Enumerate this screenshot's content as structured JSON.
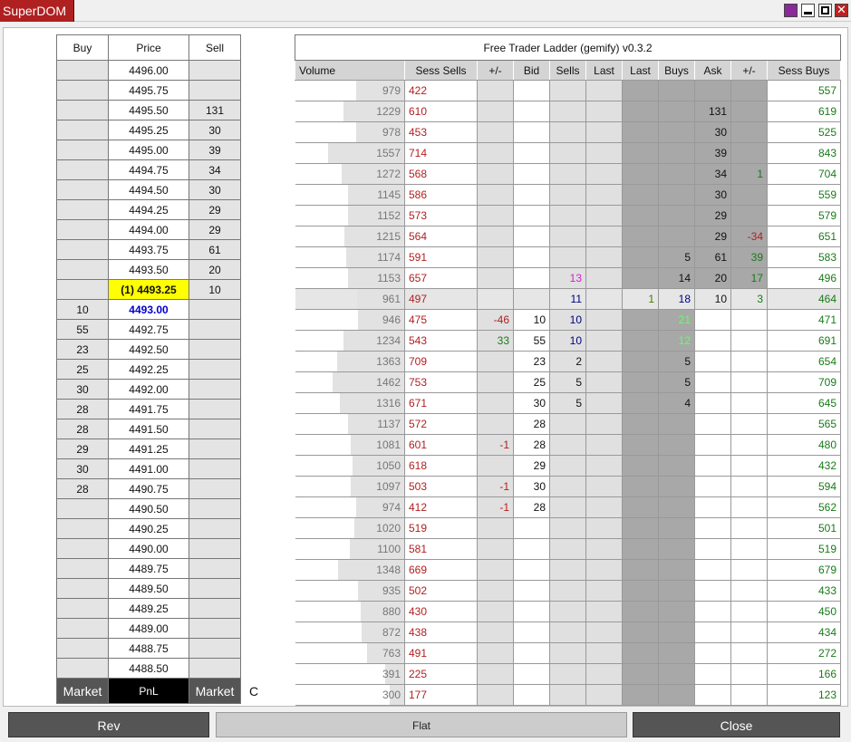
{
  "window": {
    "title": "SuperDOM"
  },
  "left": {
    "headers": [
      "Buy",
      "Price",
      "Sell"
    ],
    "rows": [
      {
        "buy": "",
        "price": "4496.00",
        "sell": ""
      },
      {
        "buy": "",
        "price": "4495.75",
        "sell": ""
      },
      {
        "buy": "",
        "price": "4495.50",
        "sell": "131"
      },
      {
        "buy": "",
        "price": "4495.25",
        "sell": "30"
      },
      {
        "buy": "",
        "price": "4495.00",
        "sell": "39"
      },
      {
        "buy": "",
        "price": "4494.75",
        "sell": "34"
      },
      {
        "buy": "",
        "price": "4494.50",
        "sell": "30"
      },
      {
        "buy": "",
        "price": "4494.25",
        "sell": "29"
      },
      {
        "buy": "",
        "price": "4494.00",
        "sell": "29"
      },
      {
        "buy": "",
        "price": "4493.75",
        "sell": "61"
      },
      {
        "buy": "",
        "price": "4493.50",
        "sell": "20"
      },
      {
        "buy": "",
        "price": "(1) 4493.25",
        "sell": "10",
        "highlight": "position"
      },
      {
        "buy": "10",
        "price": "4493.00",
        "sell": "",
        "highlight": "bid"
      },
      {
        "buy": "55",
        "price": "4492.75",
        "sell": ""
      },
      {
        "buy": "23",
        "price": "4492.50",
        "sell": ""
      },
      {
        "buy": "25",
        "price": "4492.25",
        "sell": ""
      },
      {
        "buy": "30",
        "price": "4492.00",
        "sell": ""
      },
      {
        "buy": "28",
        "price": "4491.75",
        "sell": ""
      },
      {
        "buy": "28",
        "price": "4491.50",
        "sell": ""
      },
      {
        "buy": "29",
        "price": "4491.25",
        "sell": ""
      },
      {
        "buy": "30",
        "price": "4491.00",
        "sell": ""
      },
      {
        "buy": "28",
        "price": "4490.75",
        "sell": ""
      },
      {
        "buy": "",
        "price": "4490.50",
        "sell": ""
      },
      {
        "buy": "",
        "price": "4490.25",
        "sell": ""
      },
      {
        "buy": "",
        "price": "4490.00",
        "sell": ""
      },
      {
        "buy": "",
        "price": "4489.75",
        "sell": ""
      },
      {
        "buy": "",
        "price": "4489.50",
        "sell": ""
      },
      {
        "buy": "",
        "price": "4489.25",
        "sell": ""
      },
      {
        "buy": "",
        "price": "4489.00",
        "sell": ""
      },
      {
        "buy": "",
        "price": "4488.75",
        "sell": ""
      },
      {
        "buy": "",
        "price": "4488.50",
        "sell": ""
      }
    ],
    "footer": [
      "Market",
      "PnL",
      "Market"
    ],
    "c_label": "C"
  },
  "right": {
    "title": "Free Trader Ladder (gemify) v0.3.2",
    "headers": [
      "Volume",
      "Sess Sells",
      "+/-",
      "Bid",
      "Sells",
      "Last",
      "Last",
      "Buys",
      "Ask",
      "+/-",
      "Sess Buys"
    ],
    "max_volume": 1557,
    "rows": [
      {
        "vol": "979",
        "ss": "422",
        "pmb": "",
        "bid": "",
        "sells": "",
        "lastL": "",
        "lastR": "",
        "buys": "",
        "ask": "",
        "pma": "",
        "sb": "557"
      },
      {
        "vol": "1229",
        "ss": "610",
        "pmb": "",
        "bid": "",
        "sells": "",
        "lastL": "",
        "lastR": "",
        "buys": "",
        "ask": "131",
        "pma": "",
        "sb": "619"
      },
      {
        "vol": "978",
        "ss": "453",
        "pmb": "",
        "bid": "",
        "sells": "",
        "lastL": "",
        "lastR": "",
        "buys": "",
        "ask": "30",
        "pma": "",
        "sb": "525"
      },
      {
        "vol": "1557",
        "ss": "714",
        "pmb": "",
        "bid": "",
        "sells": "",
        "lastL": "",
        "lastR": "",
        "buys": "",
        "ask": "39",
        "pma": "",
        "sb": "843"
      },
      {
        "vol": "1272",
        "ss": "568",
        "pmb": "",
        "bid": "",
        "sells": "",
        "lastL": "",
        "lastR": "",
        "buys": "",
        "ask": "34",
        "pma": "1",
        "sb": "704"
      },
      {
        "vol": "1145",
        "ss": "586",
        "pmb": "",
        "bid": "",
        "sells": "",
        "lastL": "",
        "lastR": "",
        "buys": "",
        "ask": "30",
        "pma": "",
        "sb": "559"
      },
      {
        "vol": "1152",
        "ss": "573",
        "pmb": "",
        "bid": "",
        "sells": "",
        "lastL": "",
        "lastR": "",
        "buys": "",
        "ask": "29",
        "pma": "",
        "sb": "579"
      },
      {
        "vol": "1215",
        "ss": "564",
        "pmb": "",
        "bid": "",
        "sells": "",
        "lastL": "",
        "lastR": "",
        "buys": "",
        "ask": "29",
        "pma": "-34",
        "sb": "651"
      },
      {
        "vol": "1174",
        "ss": "591",
        "pmb": "",
        "bid": "",
        "sells": "",
        "lastL": "",
        "lastR": "",
        "buys": "5",
        "ask": "61",
        "pma": "39",
        "sb": "583"
      },
      {
        "vol": "1153",
        "ss": "657",
        "pmb": "",
        "bid": "",
        "sells": "13",
        "lastL": "",
        "lastR": "",
        "buys": "14",
        "ask": "20",
        "pma": "17",
        "sb": "496"
      },
      {
        "vol": "961",
        "ss": "497",
        "pmb": "",
        "bid": "",
        "sells": "11",
        "lastL": "",
        "lastR": "1",
        "buys": "18",
        "ask": "10",
        "pma": "3",
        "sb": "464",
        "current": true
      },
      {
        "vol": "946",
        "ss": "475",
        "pmb": "-46",
        "bid": "10",
        "sells": "10",
        "lastL": "",
        "lastR": "",
        "buys": "21",
        "ask": "",
        "pma": "",
        "sb": "471"
      },
      {
        "vol": "1234",
        "ss": "543",
        "pmb": "33",
        "bid": "55",
        "sells": "10",
        "lastL": "",
        "lastR": "",
        "buys": "12",
        "ask": "",
        "pma": "",
        "sb": "691"
      },
      {
        "vol": "1363",
        "ss": "709",
        "pmb": "",
        "bid": "23",
        "sells": "2",
        "lastL": "",
        "lastR": "",
        "buys": "5",
        "ask": "",
        "pma": "",
        "sb": "654"
      },
      {
        "vol": "1462",
        "ss": "753",
        "pmb": "",
        "bid": "25",
        "sells": "5",
        "lastL": "",
        "lastR": "",
        "buys": "5",
        "ask": "",
        "pma": "",
        "sb": "709"
      },
      {
        "vol": "1316",
        "ss": "671",
        "pmb": "",
        "bid": "30",
        "sells": "5",
        "lastL": "",
        "lastR": "",
        "buys": "4",
        "ask": "",
        "pma": "",
        "sb": "645"
      },
      {
        "vol": "1137",
        "ss": "572",
        "pmb": "",
        "bid": "28",
        "sells": "",
        "lastL": "",
        "lastR": "",
        "buys": "",
        "ask": "",
        "pma": "",
        "sb": "565"
      },
      {
        "vol": "1081",
        "ss": "601",
        "pmb": "-1",
        "bid": "28",
        "sells": "",
        "lastL": "",
        "lastR": "",
        "buys": "",
        "ask": "",
        "pma": "",
        "sb": "480"
      },
      {
        "vol": "1050",
        "ss": "618",
        "pmb": "",
        "bid": "29",
        "sells": "",
        "lastL": "",
        "lastR": "",
        "buys": "",
        "ask": "",
        "pma": "",
        "sb": "432"
      },
      {
        "vol": "1097",
        "ss": "503",
        "pmb": "-1",
        "bid": "30",
        "sells": "",
        "lastL": "",
        "lastR": "",
        "buys": "",
        "ask": "",
        "pma": "",
        "sb": "594"
      },
      {
        "vol": "974",
        "ss": "412",
        "pmb": "-1",
        "bid": "28",
        "sells": "",
        "lastL": "",
        "lastR": "",
        "buys": "",
        "ask": "",
        "pma": "",
        "sb": "562"
      },
      {
        "vol": "1020",
        "ss": "519",
        "pmb": "",
        "bid": "",
        "sells": "",
        "lastL": "",
        "lastR": "",
        "buys": "",
        "ask": "",
        "pma": "",
        "sb": "501"
      },
      {
        "vol": "1100",
        "ss": "581",
        "pmb": "",
        "bid": "",
        "sells": "",
        "lastL": "",
        "lastR": "",
        "buys": "",
        "ask": "",
        "pma": "",
        "sb": "519"
      },
      {
        "vol": "1348",
        "ss": "669",
        "pmb": "",
        "bid": "",
        "sells": "",
        "lastL": "",
        "lastR": "",
        "buys": "",
        "ask": "",
        "pma": "",
        "sb": "679"
      },
      {
        "vol": "935",
        "ss": "502",
        "pmb": "",
        "bid": "",
        "sells": "",
        "lastL": "",
        "lastR": "",
        "buys": "",
        "ask": "",
        "pma": "",
        "sb": "433"
      },
      {
        "vol": "880",
        "ss": "430",
        "pmb": "",
        "bid": "",
        "sells": "",
        "lastL": "",
        "lastR": "",
        "buys": "",
        "ask": "",
        "pma": "",
        "sb": "450"
      },
      {
        "vol": "872",
        "ss": "438",
        "pmb": "",
        "bid": "",
        "sells": "",
        "lastL": "",
        "lastR": "",
        "buys": "",
        "ask": "",
        "pma": "",
        "sb": "434"
      },
      {
        "vol": "763",
        "ss": "491",
        "pmb": "",
        "bid": "",
        "sells": "",
        "lastL": "",
        "lastR": "",
        "buys": "",
        "ask": "",
        "pma": "",
        "sb": "272"
      },
      {
        "vol": "391",
        "ss": "225",
        "pmb": "",
        "bid": "",
        "sells": "",
        "lastL": "",
        "lastR": "",
        "buys": "",
        "ask": "",
        "pma": "",
        "sb": "166"
      },
      {
        "vol": "300",
        "ss": "177",
        "pmb": "",
        "bid": "",
        "sells": "",
        "lastL": "",
        "lastR": "",
        "buys": "",
        "ask": "",
        "pma": "",
        "sb": "123"
      }
    ]
  },
  "bottom": {
    "rev": "Rev",
    "flat": "Flat",
    "close": "Close"
  },
  "colors": {
    "title_bg": "#b02020",
    "position_highlight": "#ffff00",
    "sell_text": "#b22020",
    "buy_text": "#1a7a1a",
    "dark_column": "#a8a8a8",
    "light_column": "#e0e0e0"
  }
}
